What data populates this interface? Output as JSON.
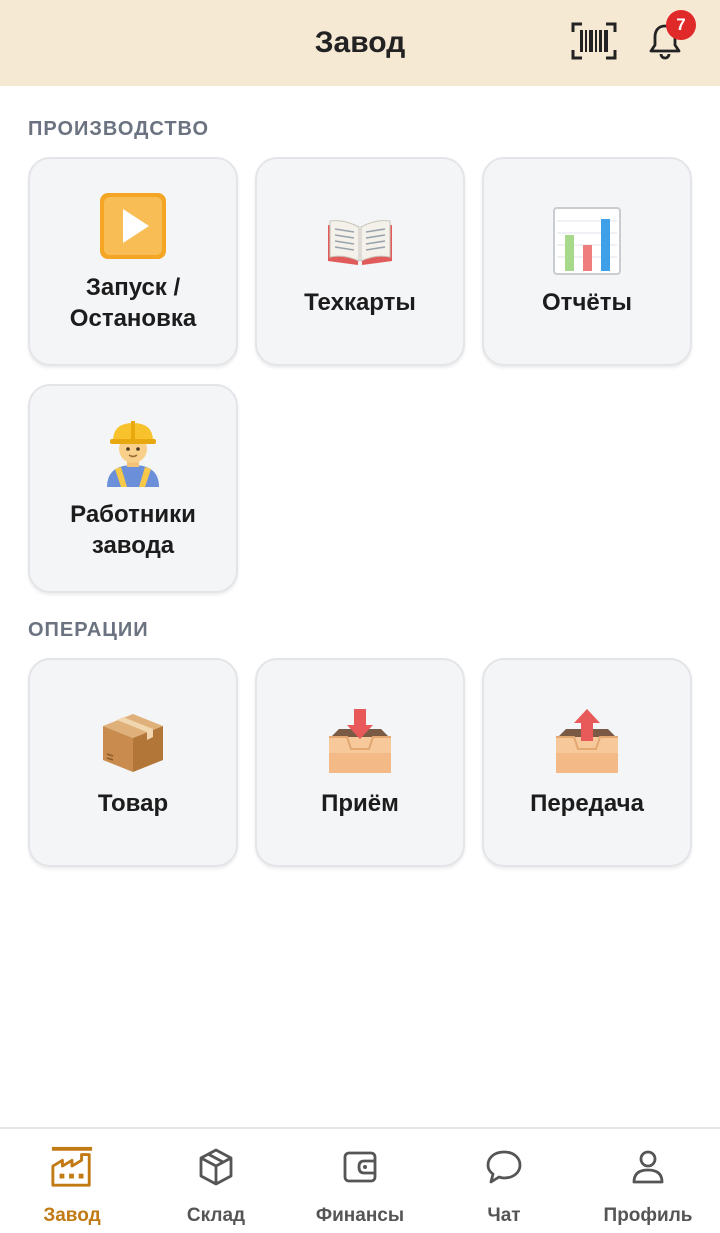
{
  "header": {
    "title": "Завод",
    "notification_count": "7"
  },
  "sections": [
    {
      "title": "ПРОИЗВОДСТВО",
      "tiles": [
        {
          "label_line1": "Запуск /",
          "label_line2": "Остановка",
          "icon": "play-button-icon"
        },
        {
          "label": "Техкарты",
          "icon": "open-book-icon"
        },
        {
          "label": "Отчёты",
          "icon": "bar-chart-icon"
        },
        {
          "label_line1": "Работники",
          "label_line2": "завода",
          "icon": "construction-worker-icon"
        }
      ]
    },
    {
      "title": "ОПЕРАЦИИ",
      "tiles": [
        {
          "label": "Товар",
          "icon": "package-icon"
        },
        {
          "label": "Приём",
          "icon": "inbox-tray-icon"
        },
        {
          "label": "Передача",
          "icon": "outbox-tray-icon"
        }
      ]
    }
  ],
  "bottom_nav": [
    {
      "label": "Завод",
      "icon": "factory-icon",
      "active": true
    },
    {
      "label": "Склад",
      "icon": "box-icon"
    },
    {
      "label": "Финансы",
      "icon": "wallet-icon"
    },
    {
      "label": "Чат",
      "icon": "chat-bubble-icon"
    },
    {
      "label": "Профиль",
      "icon": "user-icon"
    }
  ],
  "colors": {
    "header_bg": "#f5e9d4",
    "accent": "#c17a14",
    "badge": "#e02a2a"
  }
}
